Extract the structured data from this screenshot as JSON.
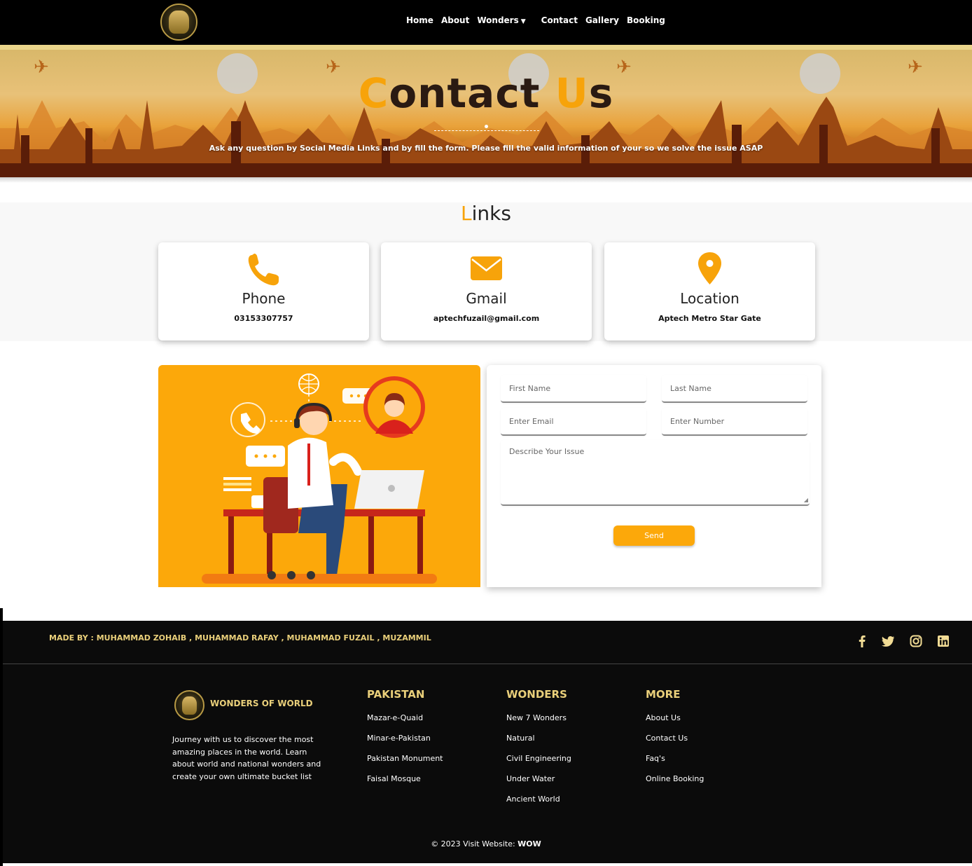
{
  "nav": {
    "links": [
      "Home",
      "About",
      "Wonders",
      "Contact",
      "Gallery",
      "Booking"
    ]
  },
  "hero": {
    "title_first_letter": "C",
    "title_rest_1": "ontact ",
    "title_second_letter": "U",
    "title_rest_2": "s",
    "subtitle": "Ask any question by Social Media Links and by fill the form. Please fill the valid information of your so we solve the issue ASAP"
  },
  "links_section": {
    "title_first_letter": "L",
    "title_rest": "inks",
    "cards": [
      {
        "icon": "phone-icon",
        "title": "Phone",
        "value": "03153307757"
      },
      {
        "icon": "envelope-icon",
        "title": "Gmail",
        "value": "aptechfuzail@gmail.com"
      },
      {
        "icon": "location-pin-icon",
        "title": "Location",
        "value": "Aptech Metro Star Gate"
      }
    ]
  },
  "form": {
    "first_name_placeholder": "First Name",
    "last_name_placeholder": "Last Name",
    "email_placeholder": "Enter Email",
    "number_placeholder": "Enter Number",
    "issue_placeholder": "Describe Your Issue",
    "send_label": "Send"
  },
  "footer": {
    "made_by": "MADE BY : MUHAMMAD ZOHAIB , MUHAMMAD RAFAY , MUHAMMAD FUZAIL , MUZAMMIL",
    "social_icons": [
      "facebook-icon",
      "twitter-icon",
      "instagram-icon",
      "linkedin-icon"
    ],
    "brand": "WONDERS OF WORLD",
    "about": "Journey with us to discover the most amazing places in the world. Learn about world and national wonders and create your own ultimate bucket list",
    "columns": [
      {
        "title": "PAKISTAN",
        "items": [
          "Mazar-e-Quaid",
          "Minar-e-Pakistan",
          "Pakistan Monument",
          "Faisal Mosque"
        ]
      },
      {
        "title": "WONDERS",
        "items": [
          "New 7 Wonders",
          "Natural",
          "Civil Engineering",
          "Under Water",
          "Ancient World"
        ]
      },
      {
        "title": "MORE",
        "items": [
          "About Us",
          "Contact Us",
          "Faq's",
          "Online Booking"
        ]
      }
    ],
    "copyright_prefix": "© 2023 Visit Website: ",
    "copyright_site": "WOW"
  },
  "colors": {
    "accent": "#fca80a",
    "gold": "#e9cf7a",
    "footer_bg": "#0b0b0b"
  }
}
